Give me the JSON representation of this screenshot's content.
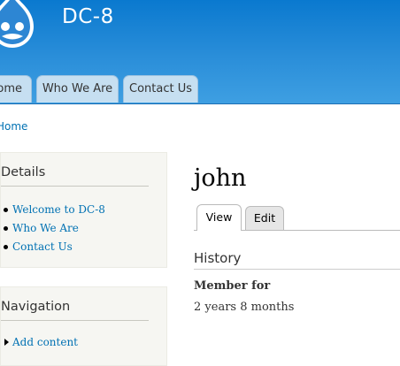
{
  "header": {
    "site_name": "DC-8",
    "brand_color": "#0a79cf"
  },
  "main_menu": {
    "items": [
      {
        "label": "Home"
      },
      {
        "label": "Who We Are"
      },
      {
        "label": "Contact Us"
      }
    ]
  },
  "breadcrumb": {
    "home_label": "Home"
  },
  "sidebar": {
    "details": {
      "title": "Details",
      "links": [
        "Welcome to DC-8",
        "Who We Are",
        "Contact Us"
      ]
    },
    "navigation": {
      "title": "Navigation",
      "links": [
        "Add content"
      ]
    }
  },
  "main": {
    "title": "john",
    "tabs": [
      {
        "label": "View",
        "active": true
      },
      {
        "label": "Edit",
        "active": false
      }
    ],
    "history": {
      "heading": "History",
      "member_for_label": "Member for",
      "member_for_value": "2 years 8 months"
    }
  }
}
